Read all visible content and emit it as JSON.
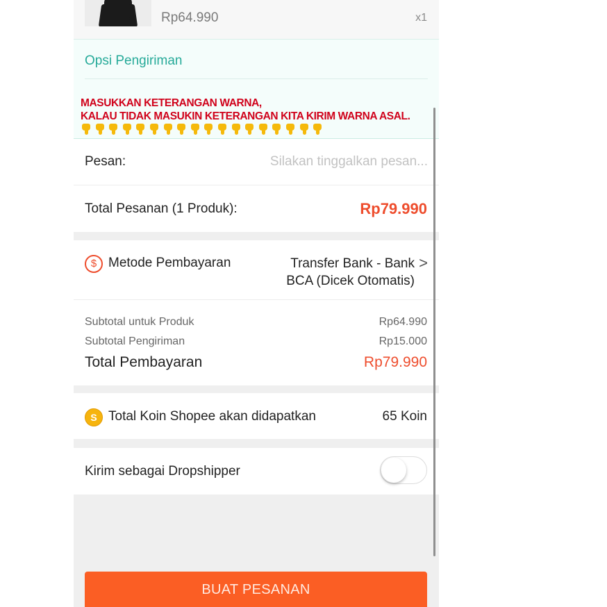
{
  "product": {
    "price": "Rp64.990",
    "quantity": "x1"
  },
  "shipping": {
    "title": "Opsi Pengiriman",
    "notice_line1": "MASUKKAN KETERANGAN WARNA,",
    "notice_line2": "KALAU TIDAK MASUKIN KETERANGAN KITA KIRIM WARNA ASAL.",
    "emoji_icon": "pointing-down-hand-icon",
    "emoji_count": 18
  },
  "message": {
    "label": "Pesan:",
    "placeholder": "Silakan tinggalkan pesan..."
  },
  "order_total": {
    "label": "Total Pesanan (1 Produk):",
    "value": "Rp79.990"
  },
  "payment": {
    "icon": "dollar-icon",
    "label": "Metode Pembayaran",
    "value_line1": "Transfer Bank - Bank",
    "value_line2": "BCA (Dicek Otomatis)",
    "chevron": ">"
  },
  "summary": {
    "subtotal_product_label": "Subtotal untuk Produk",
    "subtotal_product_value": "Rp64.990",
    "subtotal_shipping_label": "Subtotal Pengiriman",
    "subtotal_shipping_value": "Rp15.000",
    "total_label": "Total Pembayaran",
    "total_value": "Rp79.990"
  },
  "coins": {
    "icon": "shopee-coin-icon",
    "symbol": "S",
    "label": "Total Koin Shopee akan didapatkan",
    "value": "65 Koin"
  },
  "dropship": {
    "label": "Kirim sebagai Dropshipper",
    "enabled": false
  },
  "action": {
    "button_label": "BUAT PESANAN"
  },
  "colors": {
    "accent": "#ee4d2d",
    "button": "#fb5e24",
    "shipping_text": "#26aa99",
    "notice_text": "#d0021b"
  }
}
